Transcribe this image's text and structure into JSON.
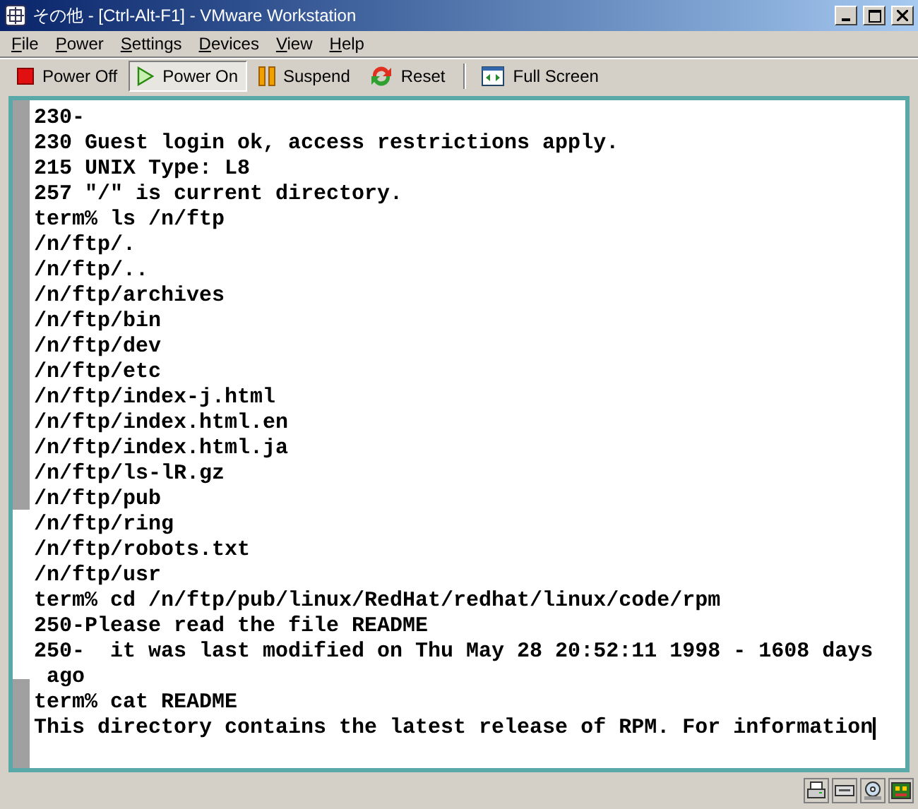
{
  "window": {
    "title": "その他 - [Ctrl-Alt-F1] - VMware Workstation"
  },
  "menu": [
    {
      "label": "File"
    },
    {
      "label": "Power"
    },
    {
      "label": "Settings"
    },
    {
      "label": "Devices"
    },
    {
      "label": "View"
    },
    {
      "label": "Help"
    }
  ],
  "toolbar": [
    {
      "kind": "power-off",
      "label": "Power Off",
      "selected": false
    },
    {
      "kind": "power-on",
      "label": "Power On",
      "selected": true
    },
    {
      "kind": "suspend",
      "label": "Suspend",
      "selected": false
    },
    {
      "kind": "reset",
      "label": "Reset",
      "selected": false
    },
    {
      "kind": "full-screen",
      "label": "Full Screen",
      "selected": false
    }
  ],
  "terminal": {
    "lines": [
      "230-",
      "230 Guest login ok, access restrictions apply.",
      "215 UNIX Type: L8",
      "257 \"/\" is current directory.",
      "term% ls /n/ftp",
      "/n/ftp/.",
      "/n/ftp/..",
      "/n/ftp/archives",
      "/n/ftp/bin",
      "/n/ftp/dev",
      "/n/ftp/etc",
      "/n/ftp/index-j.html",
      "/n/ftp/index.html.en",
      "/n/ftp/index.html.ja",
      "/n/ftp/ls-lR.gz",
      "/n/ftp/pub",
      "/n/ftp/ring",
      "/n/ftp/robots.txt",
      "/n/ftp/usr",
      "term% cd /n/ftp/pub/linux/RedHat/redhat/linux/code/rpm",
      "250-Please read the file README",
      "250-  it was last modified on Thu May 28 20:52:11 1998 - 1608 days",
      " ago",
      "term% cat README",
      "This directory contains the latest release of RPM. For information"
    ]
  },
  "status_icons": [
    {
      "kind": "printer"
    },
    {
      "kind": "drive"
    },
    {
      "kind": "disc"
    },
    {
      "kind": "network"
    }
  ]
}
